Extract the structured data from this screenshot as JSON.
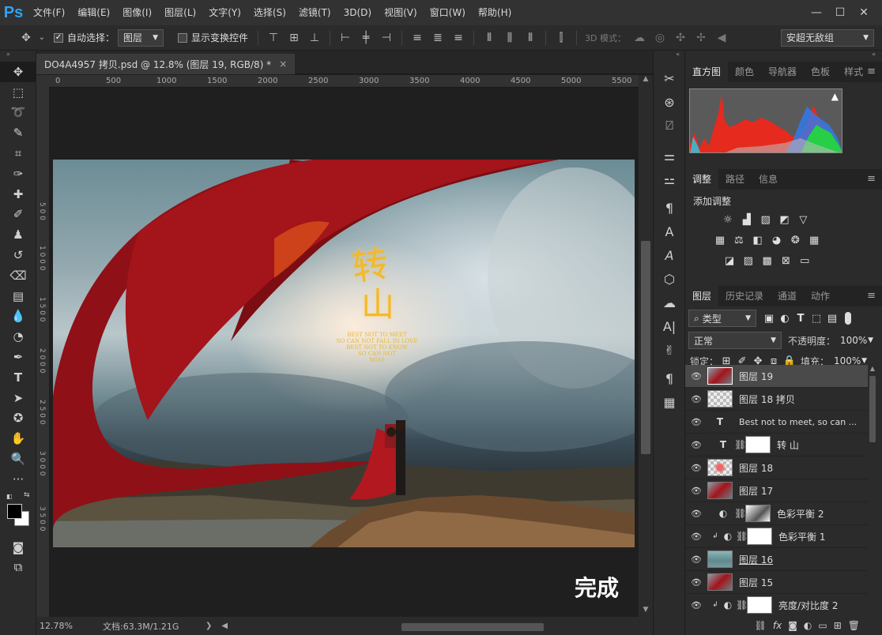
{
  "app": {
    "logo": "Ps",
    "menu": [
      "文件(F)",
      "编辑(E)",
      "图像(I)",
      "图层(L)",
      "文字(Y)",
      "选择(S)",
      "滤镜(T)",
      "3D(D)",
      "视图(V)",
      "窗口(W)",
      "帮助(H)"
    ],
    "window_controls": [
      "—",
      "☐",
      "✕"
    ]
  },
  "options": {
    "auto_select_label": "自动选择：",
    "auto_select_value": "图层",
    "show_transform_label": "显示变换控件",
    "mode3d_label": "3D 模式：",
    "workspace": "安超无敌组"
  },
  "document": {
    "tab_title": "DO4A4957 拷贝.psd @ 12.8% (图层 19, RGB/8) *",
    "tab_close": "×",
    "ruler_top": [
      "0",
      "500",
      "1000",
      "1500",
      "2000",
      "2500",
      "3000",
      "3500",
      "4000",
      "4500",
      "5000",
      "5500"
    ],
    "ruler_left": [
      "5 0 0",
      "1 0 0 0",
      "1 5 0 0",
      "2 0 0 0",
      "2 5 0 0",
      "3 0 0 0",
      "3 5 0 0"
    ],
    "poster_title_1": "转",
    "poster_title_2": "山",
    "poster_caption": [
      "BEST NOT TO MEET",
      "SO CAN NOT FALL IN LOVE",
      "BEST NOT TO KNOW",
      "SO CAN NOT",
      "MISS"
    ],
    "done_label": "完成"
  },
  "status": {
    "zoom": "12.78%",
    "doc_info": "文档:63.3M/1.21G",
    "arrow": "❯"
  },
  "panels": {
    "histogram_tabs": [
      "直方图",
      "颜色",
      "导航器",
      "色板",
      "样式"
    ],
    "adjust_tabs": [
      "调整",
      "路径",
      "信息"
    ],
    "adjust_title": "添加调整",
    "layers_tabs": [
      "图层",
      "历史记录",
      "通道",
      "动作"
    ],
    "filter_label": "类型",
    "blend_mode": "正常",
    "opacity_label": "不透明度：",
    "opacity_value": "100%",
    "lock_label": "锁定：",
    "fill_label": "填充：",
    "fill_value": "100%",
    "layers": [
      {
        "name": "图层 19",
        "kind": "image-red",
        "selected": true
      },
      {
        "name": "图层 18 拷贝",
        "kind": "transparent"
      },
      {
        "name": "Best not to meet, so can ...",
        "kind": "text"
      },
      {
        "name": "转 山",
        "kind": "text-mask"
      },
      {
        "name": "图层 18",
        "kind": "transparent-red"
      },
      {
        "name": "图层 17",
        "kind": "image-red"
      },
      {
        "name": "色彩平衡 2",
        "kind": "adjust-mask"
      },
      {
        "name": "色彩平衡 1",
        "kind": "adjust-white-clip"
      },
      {
        "name": "图层 16",
        "kind": "image-teal"
      },
      {
        "name": "图层 15",
        "kind": "image-red"
      },
      {
        "name": "亮度/对比度 2",
        "kind": "adjust-white-clip"
      }
    ]
  },
  "colors": {
    "accent": "#2fa3f6",
    "red_silk": "#a3141b",
    "title_gold": "#f2b928"
  }
}
